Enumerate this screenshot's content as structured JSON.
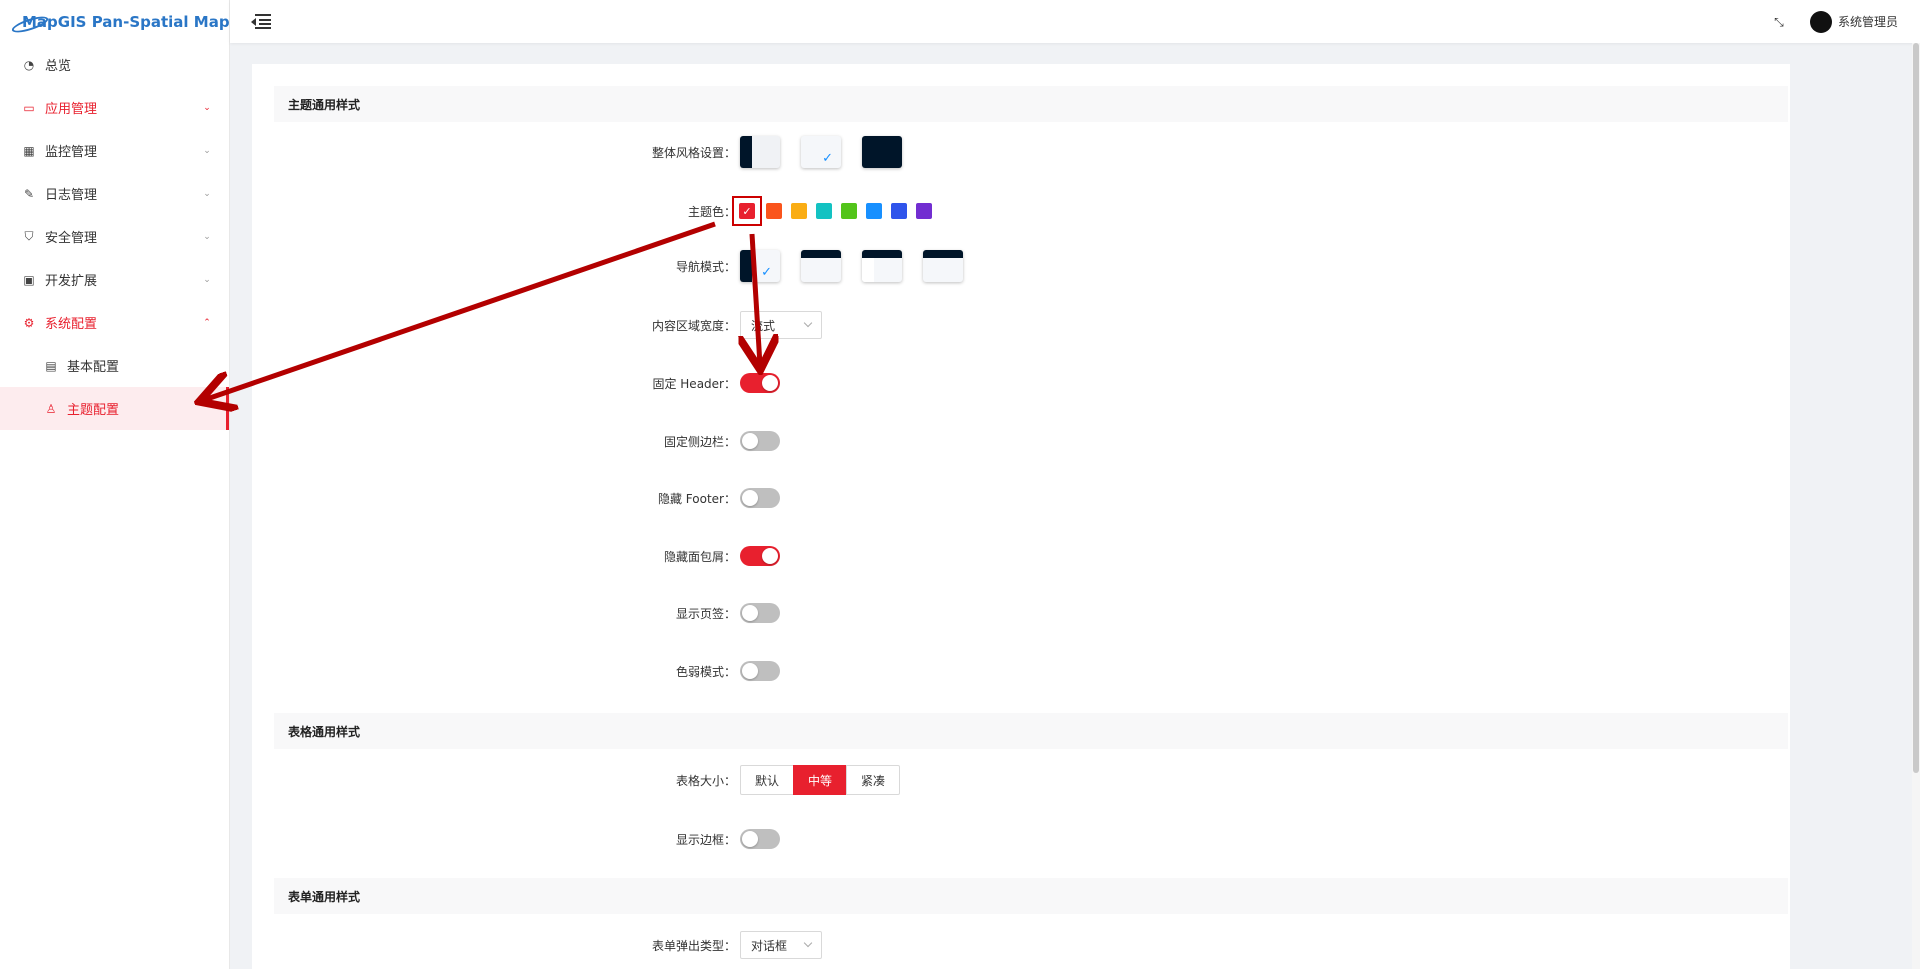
{
  "app": {
    "title": "MapGIS Pan-Spatial Map"
  },
  "header": {
    "user_name": "系统管理员"
  },
  "sidebar": {
    "items": [
      {
        "label": "总览",
        "icon": "dashboard-icon"
      },
      {
        "label": "应用管理",
        "icon": "monitor-icon"
      },
      {
        "label": "监控管理",
        "icon": "chart-icon"
      },
      {
        "label": "日志管理",
        "icon": "file-edit-icon"
      },
      {
        "label": "安全管理",
        "icon": "shield-icon"
      },
      {
        "label": "开发扩展",
        "icon": "toolbox-icon"
      },
      {
        "label": "系统配置",
        "icon": "gear-icon"
      }
    ],
    "sub_items": [
      {
        "label": "基本配置",
        "icon": "form-icon"
      },
      {
        "label": "主题配置",
        "icon": "skin-icon"
      }
    ]
  },
  "theme_section": {
    "title": "主题通用样式",
    "overall_style_label": "整体风格设置",
    "theme_color_label": "主题色",
    "theme_colors": [
      "#e8202e",
      "#fa541c",
      "#faad14",
      "#13c2c2",
      "#52c41a",
      "#1890ff",
      "#2f54eb",
      "#722ed1"
    ],
    "nav_mode_label": "导航模式",
    "content_width_label": "内容区域宽度",
    "content_width_value": "流式",
    "fixed_header_label": "固定 Header",
    "fixed_sidebar_label": "固定侧边栏",
    "hide_footer_label": "隐藏 Footer",
    "hide_breadcrumb_label": "隐藏面包屑",
    "show_tabs_label": "显示页签",
    "weak_mode_label": "色弱模式",
    "switches": {
      "fixed_header": true,
      "fixed_sidebar": false,
      "hide_footer": false,
      "hide_breadcrumb": true,
      "show_tabs": false,
      "weak_mode": false
    }
  },
  "table_section": {
    "title": "表格通用样式",
    "size_label": "表格大小",
    "size_options": [
      "默认",
      "中等",
      "紧凑"
    ],
    "size_selected": "中等",
    "show_border_label": "显示边框",
    "show_border": false
  },
  "form_section": {
    "title": "表单通用样式",
    "popup_type_label": "表单弹出类型",
    "popup_type_value": "对话框"
  },
  "colors": {
    "accent": "#e8202e",
    "annotation": "#b30000"
  }
}
